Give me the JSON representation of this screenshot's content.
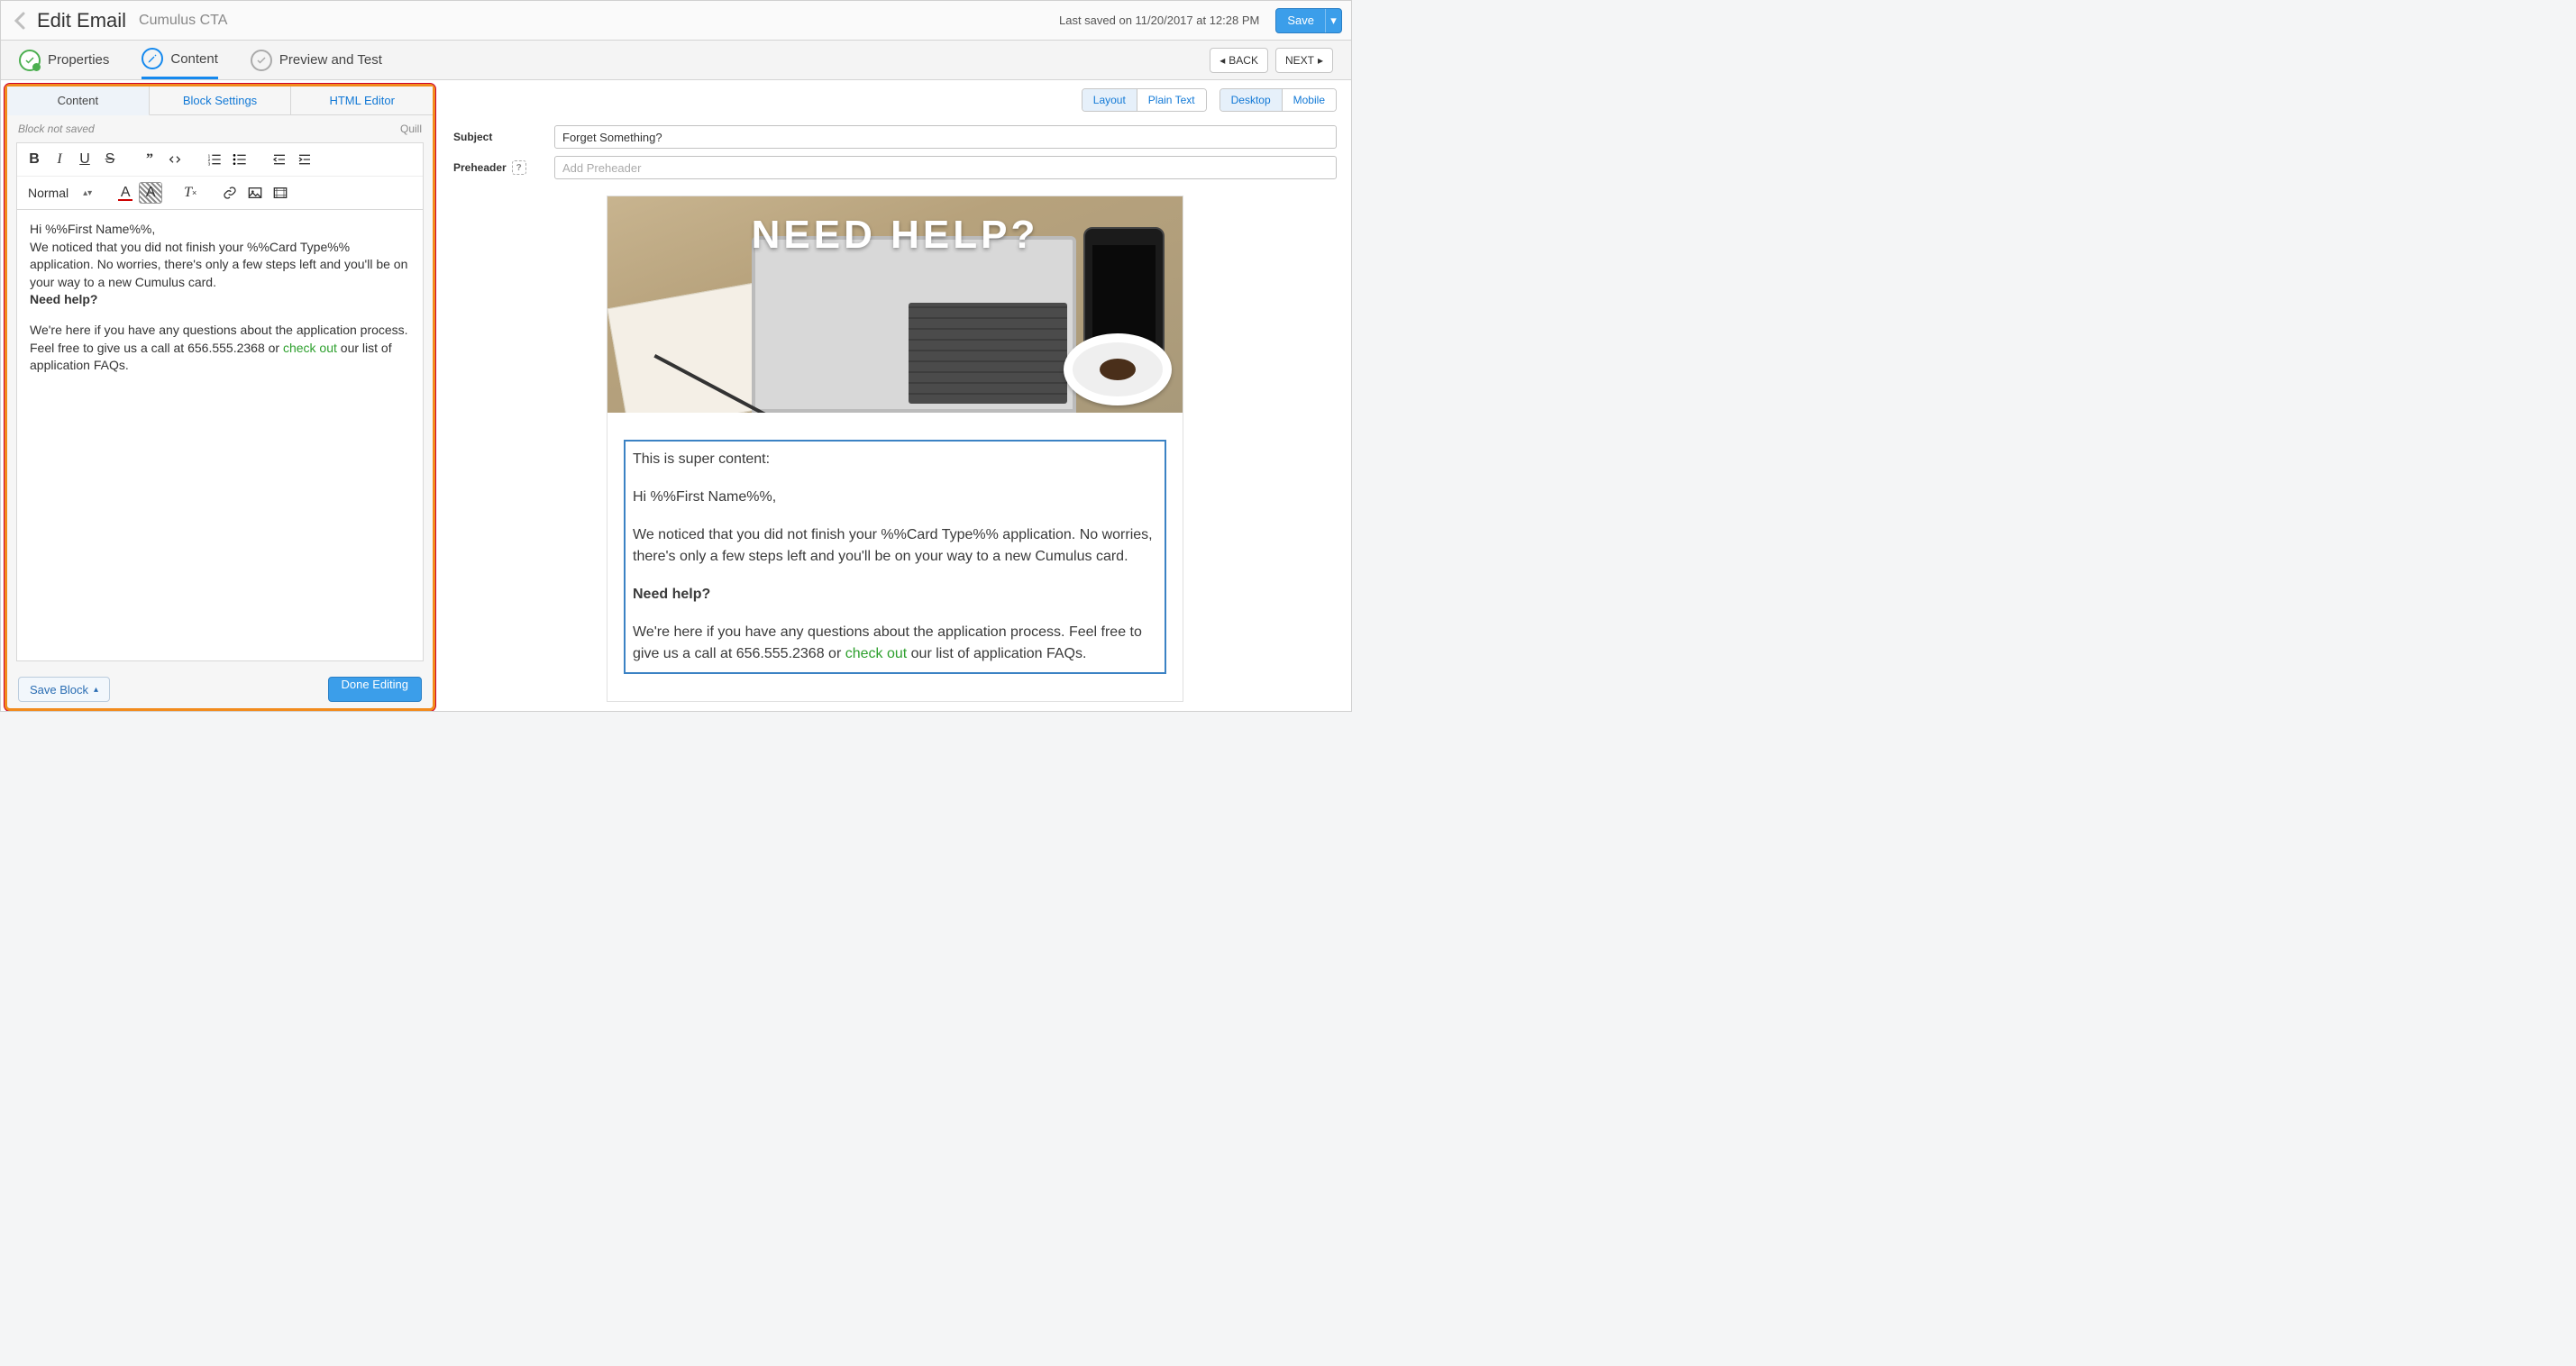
{
  "header": {
    "title": "Edit Email",
    "subtitle": "Cumulus CTA",
    "last_saved": "Last saved on 11/20/2017 at 12:28 PM",
    "save_label": "Save"
  },
  "steps": {
    "properties": "Properties",
    "content": "Content",
    "preview": "Preview and Test",
    "back": "BACK",
    "next": "NEXT"
  },
  "left": {
    "tabs": {
      "content": "Content",
      "block_settings": "Block Settings",
      "html_editor": "HTML Editor"
    },
    "status": "Block not saved",
    "engine": "Quill",
    "format_select": "Normal",
    "body": {
      "greeting": "Hi %%First Name%%,",
      "p1": "We noticed that you did not finish your %%Card Type%% application. No worries, there's only a few steps left and you'll be on your way to a new Cumulus card.",
      "need_help": "Need help?",
      "p2a": "We're here if you have any questions about the application process. Feel free to give us a call at 656.555.2368 or ",
      "link": "check out",
      "p2b": " our list of application FAQs."
    },
    "save_block": "Save Block",
    "done_editing": "Done Editing"
  },
  "right": {
    "pills": {
      "layout": "Layout",
      "plain": "Plain Text",
      "desktop": "Desktop",
      "mobile": "Mobile"
    },
    "subject_label": "Subject",
    "subject_value": "Forget Something?",
    "preheader_label": "Preheader",
    "preheader_placeholder": "Add Preheader",
    "hero_text": "NEED HELP?",
    "preview": {
      "intro": "This is super content:",
      "greeting": "Hi %%First Name%%,",
      "p1": "We noticed that you did not finish your %%Card Type%% application. No worries, there's only a few steps left and you'll be on your way to a new Cumulus card.",
      "need_help": "Need help?",
      "p2a": "We're here if you have any questions about the application process. Feel free to give us a call at 656.555.2368 or ",
      "link": "check out",
      "p2b": " our list of application FAQs."
    }
  }
}
